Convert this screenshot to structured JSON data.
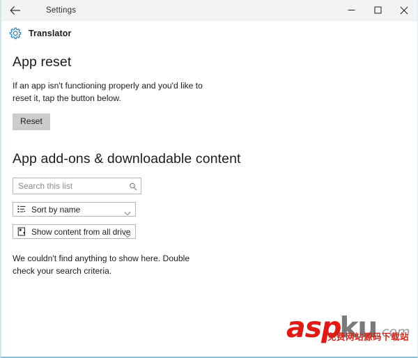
{
  "window": {
    "titlebar": {
      "back_label": "back-arrow",
      "title": "Settings",
      "minimize": "minimize",
      "maximize": "maximize",
      "close": "close"
    },
    "app_header": {
      "icon": "gear-icon",
      "name": "Translator"
    }
  },
  "main": {
    "reset_section": {
      "heading": "App reset",
      "description": "If an app isn't functioning properly and you'd like to reset it, tap the button below.",
      "reset_button_label": "Reset"
    },
    "addons_section": {
      "heading": "App add-ons & downloadable content",
      "search": {
        "placeholder": "Search this list",
        "value": "",
        "icon": "search-icon"
      },
      "sort_dropdown": {
        "label": "Sort by name",
        "icon": "sort-list-icon",
        "chevron": "chevron-down-icon"
      },
      "drives_dropdown": {
        "label": "Show content from all drives",
        "icon": "drive-icon",
        "chevron": "chevron-down-icon"
      },
      "empty_message": "We couldn't find anything to show here. Double check your search criteria."
    }
  },
  "watermark": {
    "text_asp": "asp",
    "text_ku": "ku",
    "text_com": ".com",
    "text_cn": "免费网站源码下载站",
    "color_red": "#e01b15",
    "color_gray": "#5d5d5d"
  }
}
